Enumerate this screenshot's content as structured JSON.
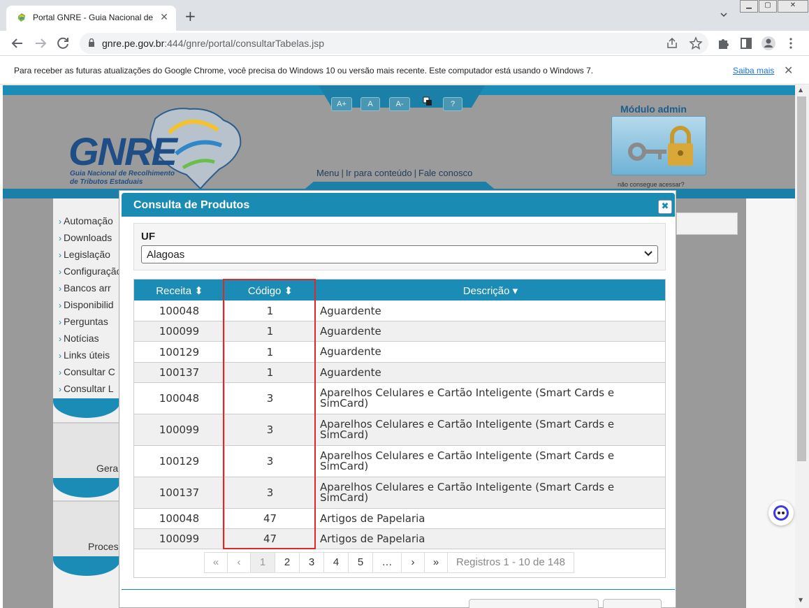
{
  "browser": {
    "tab_title": "Portal GNRE - Guia Nacional de Reco",
    "url_host": "gnre.pe.gov.br",
    "url_path": ":444/gnre/portal/consultarTabelas.jsp",
    "infobar_text": "Para receber as futuras atualizações do Google Chrome, você precisa do Windows 10 ou versão mais recente. Este computador está usando o Windows 7.",
    "infobar_link": "Saiba mais"
  },
  "header": {
    "font_buttons": [
      "A+",
      "A",
      "A-"
    ],
    "help_button": "?",
    "logo_text": "GNRE",
    "logo_sub1": "Guia Nacional de Recolhimento",
    "logo_sub2": "de Tributos Estaduais",
    "nav": [
      "Menu",
      "Ir para conteúdo",
      "Fale conosco"
    ],
    "admin_title": "Módulo admin",
    "admin_help": "não consegue acessar?"
  },
  "sidebar": {
    "items": [
      "Automação",
      "Downloads",
      "Legislação",
      "Configuração",
      "Bancos arr",
      "Disponibilid",
      "Perguntas",
      "Notícias",
      "Links úteis",
      "Consultar C",
      "Consultar L"
    ],
    "box1_label": "Gera",
    "box2_label": "Proces"
  },
  "modal": {
    "title": "Consulta de Produtos",
    "uf_label": "UF",
    "uf_value": "Alagoas",
    "columns": [
      "Receita",
      "Código",
      "Descrição"
    ],
    "rows": [
      {
        "receita": "100048",
        "codigo": "1",
        "descricao": "Aguardente"
      },
      {
        "receita": "100099",
        "codigo": "1",
        "descricao": "Aguardente"
      },
      {
        "receita": "100129",
        "codigo": "1",
        "descricao": "Aguardente"
      },
      {
        "receita": "100137",
        "codigo": "1",
        "descricao": "Aguardente"
      },
      {
        "receita": "100048",
        "codigo": "3",
        "descricao": "Aparelhos Celulares e Cartão Inteligente (Smart Cards e SimCard)"
      },
      {
        "receita": "100099",
        "codigo": "3",
        "descricao": "Aparelhos Celulares e Cartão Inteligente (Smart Cards e SimCard)"
      },
      {
        "receita": "100129",
        "codigo": "3",
        "descricao": "Aparelhos Celulares e Cartão Inteligente (Smart Cards e SimCard)"
      },
      {
        "receita": "100137",
        "codigo": "3",
        "descricao": "Aparelhos Celulares e Cartão Inteligente (Smart Cards e SimCard)"
      },
      {
        "receita": "100048",
        "codigo": "47",
        "descricao": "Artigos de Papelaria"
      },
      {
        "receita": "100099",
        "codigo": "47",
        "descricao": "Artigos de Papelaria"
      }
    ],
    "pager": {
      "first": "«",
      "prev": "‹",
      "pages": [
        "1",
        "2",
        "3",
        "4",
        "5"
      ],
      "ellipsis": "…",
      "next": "›",
      "last": "»",
      "info": "Registros 1 - 10 de 148"
    }
  }
}
